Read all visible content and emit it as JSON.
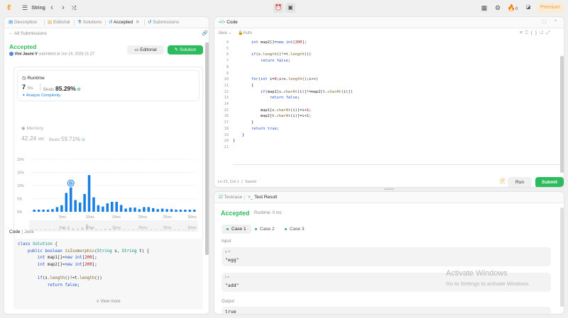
{
  "topbar": {
    "problem_title": "String",
    "nav_prev": "‹",
    "nav_next": "›",
    "shuffle": "⤨",
    "streak_count": "0",
    "premium_label": "Premium"
  },
  "left": {
    "tabs": [
      {
        "label": "Description"
      },
      {
        "label": "Editorial"
      },
      {
        "label": "Solutions"
      },
      {
        "label": "Accepted"
      },
      {
        "label": "Submissions"
      }
    ],
    "back_label": "All Submissions",
    "status": "Accepted",
    "author": "Vini Jasmi V",
    "submitted": "submitted at Jun 19, 2026 21:27",
    "editorial_button": "Editorial",
    "solution_button": "Solution",
    "runtime": {
      "label": "Runtime",
      "value": "7",
      "unit": "ms",
      "beats_label": "Beats",
      "beats_value": "85.29%",
      "analyze": "Analyze Complexity"
    },
    "memory": {
      "label": "Memory",
      "value": "42.24",
      "unit": "MB",
      "beats_label": "Beats",
      "beats_value": "59.71%"
    },
    "code_header": "Code",
    "code_lang": "Java",
    "code_lines": [
      "class Solution {",
      "    public boolean isIsomorphic(String s, String t) {",
      "        int map1[]=new int[200];",
      "        int map2[]=new int[200];",
      "",
      "        if(s.length()!=t.length())",
      "            return false;"
    ],
    "view_more": "View more"
  },
  "chart_data": {
    "type": "bar",
    "y_tick_labels": [
      "20%",
      "15%",
      "10%",
      "5%",
      "0%"
    ],
    "x_tick_labels": [
      "5ms",
      "10ms",
      "15ms",
      "20ms",
      "25ms",
      "30ms"
    ],
    "ylim": [
      0,
      20
    ],
    "highlight_bar_index": 8,
    "values": [
      0.8,
      0.8,
      0.8,
      0.8,
      1.0,
      1.8,
      2.5,
      7.2,
      9.3,
      4.5,
      3.5,
      6.8,
      14.0,
      5.5,
      2.5,
      2.0,
      3.2,
      3.8,
      3.8,
      2.6,
      1.2,
      1.6,
      1.6,
      1.0,
      1.8,
      1.8,
      1.4,
      1.0,
      1.2,
      1.0,
      1.0,
      0.8,
      0.8,
      0.8,
      0.8,
      0.8
    ],
    "grid": true
  },
  "code_panel": {
    "title": "Code",
    "language": "Java",
    "auto": "Auto",
    "status_position": "Ln 21, Col 1",
    "status_saved": "Saved",
    "run_label": "Run",
    "submit_label": "Submit",
    "lines": [
      {
        "n": "4",
        "t": "        int map2[]=new int[200];"
      },
      {
        "n": "5",
        "t": ""
      },
      {
        "n": "6",
        "t": "        if(s.length()!=t.length())"
      },
      {
        "n": "7",
        "t": "            return false;"
      },
      {
        "n": "8",
        "t": ""
      },
      {
        "n": "9",
        "t": ""
      },
      {
        "n": "10",
        "t": "        for(int i=0;i<s.length();i++)"
      },
      {
        "n": "11",
        "t": "        {"
      },
      {
        "n": "12",
        "t": "            if(map1[s.charAt(i)]!=map2[t.charAt(i)])"
      },
      {
        "n": "13",
        "t": "                return false;"
      },
      {
        "n": "14",
        "t": ""
      },
      {
        "n": "15",
        "t": "            map1[s.charAt(i)]=i+1;"
      },
      {
        "n": "16",
        "t": "            map2[t.charAt(i)]=i+1;"
      },
      {
        "n": "17",
        "t": "        }"
      },
      {
        "n": "18",
        "t": "        return true;"
      },
      {
        "n": "19",
        "t": "    }"
      },
      {
        "n": "20",
        "t": "}"
      },
      {
        "n": "21",
        "t": ""
      }
    ]
  },
  "test_panel": {
    "tab_testcase": "Testcase",
    "tab_result": "Test Result",
    "status": "Accepted",
    "runtime": "Runtime: 0 ms",
    "cases": [
      "Case 1",
      "Case 2",
      "Case 3"
    ],
    "input_label": "Input",
    "s_label": "s =",
    "s_value": "\"egg\"",
    "t_label": "t =",
    "t_value": "\"add\"",
    "output_label": "Output",
    "output_value": "true"
  },
  "watermark": {
    "title": "Activate Windows",
    "subtitle": "Go to Settings to activate Windows."
  },
  "colors": {
    "accepted": "#2cbb5d",
    "bar": "#1a7fe0",
    "bar_muted": "#d8d8d8",
    "premium": "#e3a44d"
  }
}
